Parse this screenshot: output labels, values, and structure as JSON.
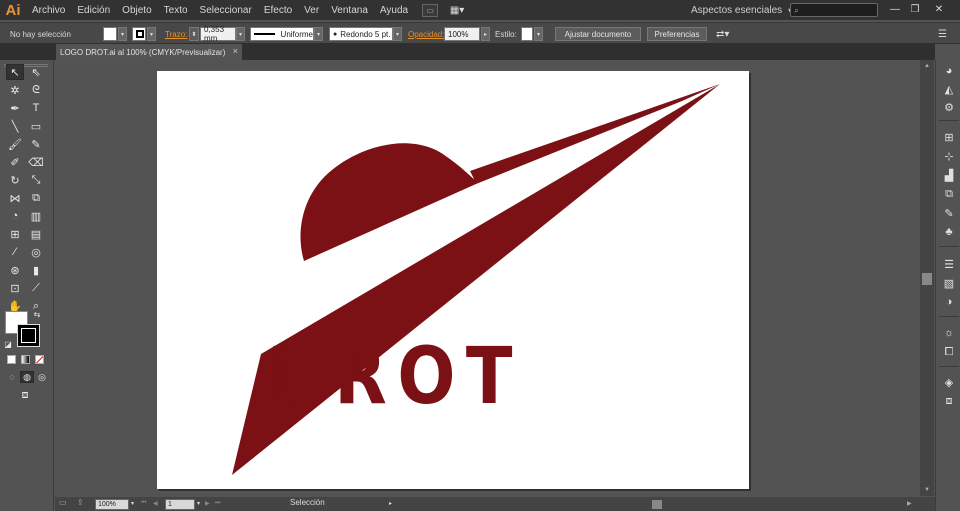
{
  "app": {
    "logo": "Ai",
    "workspace": "Aspectos esenciales",
    "brand_color": "#E8963A"
  },
  "menu": [
    "Archivo",
    "Edición",
    "Objeto",
    "Texto",
    "Seleccionar",
    "Efecto",
    "Ver",
    "Ventana",
    "Ayuda"
  ],
  "control_bar": {
    "selection_status": "No hay selección",
    "stroke_label": "Trazo:",
    "stroke_value": "0,353 mm",
    "profile": "Uniforme",
    "brush": "Redondo 5 pt.",
    "opacity_label": "Opacidad:",
    "opacity_value": "100%",
    "style_label": "Estilo:",
    "document_setup_button": "Ajustar documento",
    "preferences_button": "Preferencias"
  },
  "document_tab": {
    "title": "LOGO DROT.ai al 100% (CMYK/Previsualizar)",
    "close": "×"
  },
  "artwork": {
    "logo_text": "DROT",
    "logo_color": "#7B1115",
    "artboard_color": "#FFFFFF"
  },
  "status_bar": {
    "zoom": "100%",
    "artboard_number": "1",
    "tool_name": "Selección"
  }
}
